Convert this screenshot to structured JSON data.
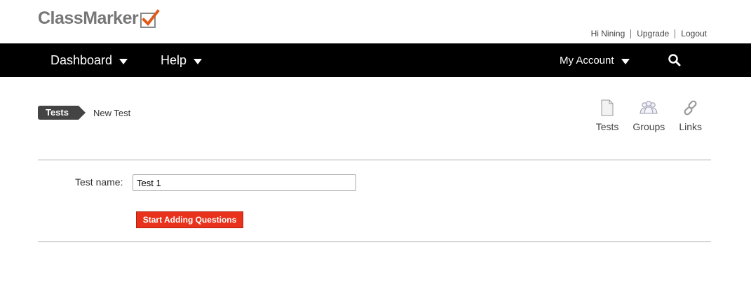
{
  "header": {
    "logo_text": "ClassMarker",
    "toplinks": {
      "greeting": "Hi Nining",
      "upgrade": "Upgrade",
      "logout": "Logout"
    }
  },
  "nav": {
    "dashboard": "Dashboard",
    "help": "Help",
    "my_account": "My Account",
    "search_icon": "search-icon"
  },
  "breadcrumb": {
    "parent": "Tests",
    "current": "New Test"
  },
  "iconlinks": [
    {
      "label": "Tests",
      "icon": "document-icon"
    },
    {
      "label": "Groups",
      "icon": "group-icon"
    },
    {
      "label": "Links",
      "icon": "link-icon"
    }
  ],
  "form": {
    "test_name_label": "Test name:",
    "test_name_value": "Test 1",
    "start_button": "Start Adding Questions"
  },
  "colors": {
    "navbar": "#000000",
    "accent_button": "#e8321c",
    "logo_check": "#e05a1a"
  }
}
